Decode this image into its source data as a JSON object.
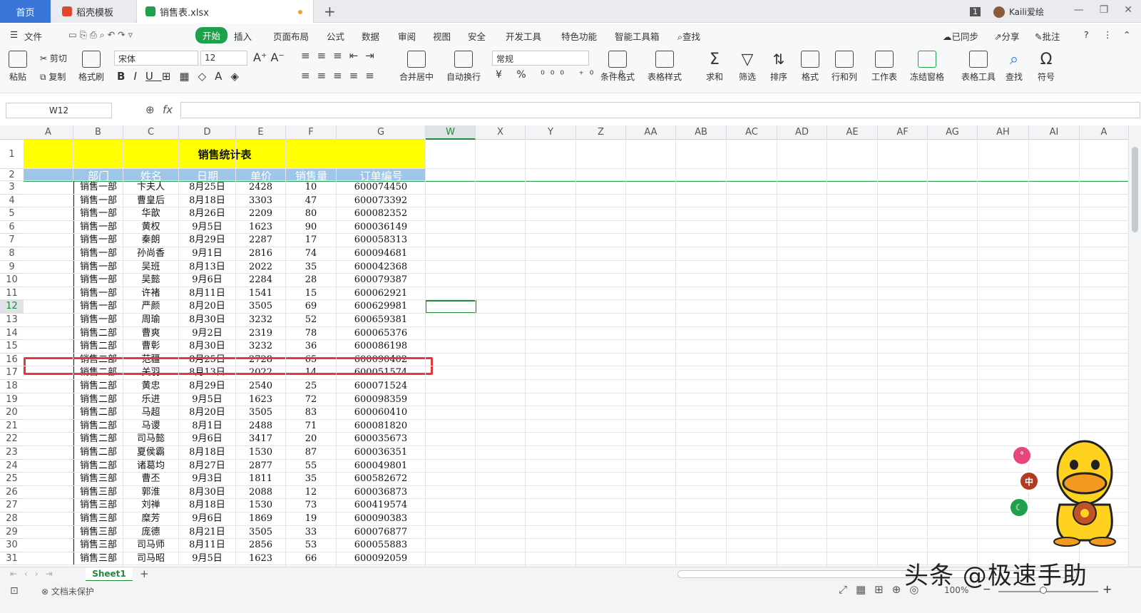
{
  "tabs": {
    "home": "首页",
    "template": "稻壳模板",
    "file": "销售表.xlsx"
  },
  "user": {
    "badge": "1",
    "name": "Kaili爱绘"
  },
  "menu": {
    "file": "文件",
    "start": "开始",
    "insert": "插入",
    "layout": "页面布局",
    "formula": "公式",
    "data": "数据",
    "review": "审阅",
    "view": "视图",
    "security": "安全",
    "dev": "开发工具",
    "special": "特色功能",
    "smart": "智能工具箱",
    "find": "查找",
    "sync": "已同步",
    "share": "分享",
    "comment": "批注"
  },
  "ribbon": {
    "paste": "粘贴",
    "cut": "剪切",
    "copy": "复制",
    "format_painter": "格式刷",
    "font": "宋体",
    "size": "12",
    "number_format": "常规",
    "merge": "合并居中",
    "wrap": "自动换行",
    "cond_format": "条件格式",
    "table_style": "表格样式",
    "sum": "求和",
    "filter": "筛选",
    "sort": "排序",
    "format": "格式",
    "rows_cols": "行和列",
    "worksheet": "工作表",
    "freeze": "冻结窗格",
    "table_tools": "表格工具",
    "find": "查找",
    "symbol": "符号"
  },
  "formula_bar": {
    "name_box": "W12",
    "fx": "fx"
  },
  "columns": [
    "A",
    "B",
    "C",
    "D",
    "E",
    "F",
    "G",
    "W",
    "X",
    "Y",
    "Z",
    "AA",
    "AB",
    "AC",
    "AD",
    "AE",
    "AF",
    "AG",
    "AH",
    "AI",
    "A"
  ],
  "rows": [
    "1",
    "2",
    "3",
    "4",
    "5",
    "6",
    "7",
    "8",
    "9",
    "10",
    "11",
    "12",
    "13",
    "14",
    "15",
    "16",
    "17",
    "18",
    "19",
    "20",
    "21",
    "22",
    "23",
    "24",
    "25",
    "26",
    "27",
    "28",
    "29",
    "30",
    "31"
  ],
  "table": {
    "title": "销售统计表",
    "headers": [
      "部门",
      "姓名",
      "日期",
      "单价",
      "销售量",
      "订单编号"
    ],
    "rows": [
      [
        "销售一部",
        "卞夫人",
        "8月25日",
        "2428",
        "10",
        "600074450"
      ],
      [
        "销售一部",
        "曹皇后",
        "8月18日",
        "3303",
        "47",
        "600073392"
      ],
      [
        "销售一部",
        "华歆",
        "8月26日",
        "2209",
        "80",
        "600082352"
      ],
      [
        "销售一部",
        "黄权",
        "9月5日",
        "1623",
        "90",
        "600036149"
      ],
      [
        "销售一部",
        "秦朗",
        "8月29日",
        "2287",
        "17",
        "600058313"
      ],
      [
        "销售一部",
        "孙尚香",
        "9月1日",
        "2816",
        "74",
        "600094681"
      ],
      [
        "销售一部",
        "吴班",
        "8月13日",
        "2022",
        "35",
        "600042368"
      ],
      [
        "销售一部",
        "吴懿",
        "9月6日",
        "2284",
        "28",
        "600079387"
      ],
      [
        "销售一部",
        "许褚",
        "8月11日",
        "1541",
        "15",
        "600062921"
      ],
      [
        "销售一部",
        "严颜",
        "8月20日",
        "3505",
        "69",
        "600629981"
      ],
      [
        "销售一部",
        "周瑜",
        "8月30日",
        "3232",
        "52",
        "600659381"
      ],
      [
        "销售二部",
        "曹爽",
        "9月2日",
        "2319",
        "78",
        "600065376"
      ],
      [
        "销售二部",
        "曹彰",
        "8月30日",
        "3232",
        "36",
        "600086198"
      ],
      [
        "销售二部",
        "范疆",
        "8月25日",
        "2728",
        "65",
        "600090402"
      ],
      [
        "销售二部",
        "关羽",
        "8月13日",
        "2022",
        "14",
        "600051574"
      ],
      [
        "销售二部",
        "黄忠",
        "8月29日",
        "2540",
        "25",
        "600071524"
      ],
      [
        "销售二部",
        "乐进",
        "9月5日",
        "1623",
        "72",
        "600098359"
      ],
      [
        "销售二部",
        "马超",
        "8月20日",
        "3505",
        "83",
        "600060410"
      ],
      [
        "销售二部",
        "马谡",
        "8月1日",
        "2488",
        "71",
        "600081820"
      ],
      [
        "销售二部",
        "司马懿",
        "9月6日",
        "3417",
        "20",
        "600035673"
      ],
      [
        "销售二部",
        "夏侯霸",
        "8月18日",
        "1530",
        "87",
        "600036351"
      ],
      [
        "销售二部",
        "诸葛均",
        "8月27日",
        "2877",
        "55",
        "600049801"
      ],
      [
        "销售三部",
        "曹丕",
        "9月3日",
        "1811",
        "35",
        "600582672"
      ],
      [
        "销售三部",
        "郭淮",
        "8月30日",
        "2088",
        "12",
        "600036873"
      ],
      [
        "销售三部",
        "刘禅",
        "8月18日",
        "1530",
        "73",
        "600419574"
      ],
      [
        "销售三部",
        "糜芳",
        "9月6日",
        "1869",
        "19",
        "600090383"
      ],
      [
        "销售三部",
        "庞德",
        "8月21日",
        "3505",
        "33",
        "600076877"
      ],
      [
        "销售三部",
        "司马师",
        "8月11日",
        "2856",
        "53",
        "600055883"
      ],
      [
        "销售三部",
        "司马昭",
        "9月5日",
        "1623",
        "66",
        "600092059"
      ]
    ]
  },
  "sheet_tab": "Sheet1",
  "status": {
    "protect": "文档未保护",
    "zoom": "100%"
  },
  "watermark": "头条 @极速手助",
  "duck_bubbles": [
    "°",
    "中",
    "☾"
  ],
  "colors": {
    "accent": "#1f8a3a",
    "title_fill": "#ffff00",
    "header_fill": "#9fc5e8",
    "highlight": "#e5383b"
  }
}
